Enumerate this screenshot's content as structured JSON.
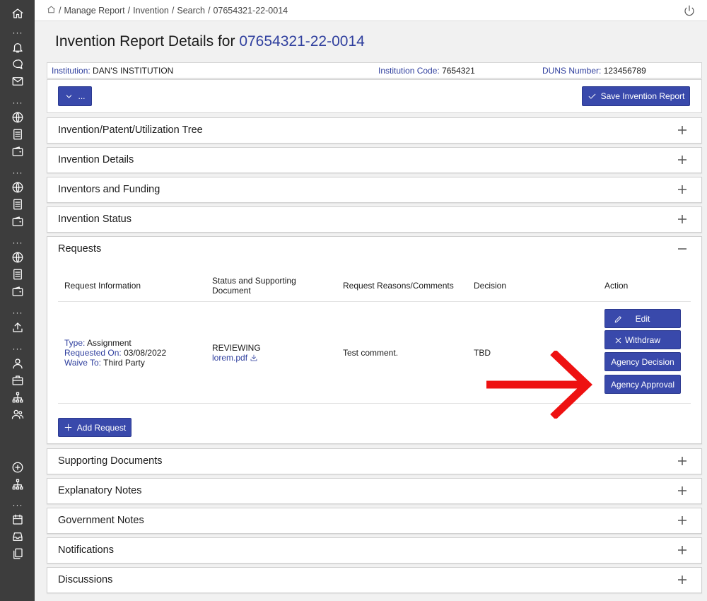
{
  "colors": {
    "accent": "#3949ab",
    "link": "#2f3f9e",
    "sidebar": "#3d3d3d",
    "annotation_arrow": "#ee1111"
  },
  "breadcrumb": {
    "items": [
      "Manage Report",
      "Invention",
      "Search",
      "07654321-22-0014"
    ],
    "separator": "/"
  },
  "page": {
    "title_prefix": "Invention Report Details for",
    "report_id": "07654321-22-0014"
  },
  "info": {
    "institution_label": "Institution:",
    "institution_value": "DAN'S INSTITUTION",
    "code_label": "Institution Code:",
    "code_value": "7654321",
    "duns_label": "DUNS Number:",
    "duns_value": "123456789"
  },
  "toolbar": {
    "more_label": "...",
    "save_label": "Save Invention Report"
  },
  "panels": {
    "tree": "Invention/Patent/Utilization Tree",
    "details": "Invention Details",
    "inventors": "Inventors and Funding",
    "status": "Invention Status",
    "requests": "Requests",
    "supporting": "Supporting Documents",
    "explanatory": "Explanatory Notes",
    "government": "Government Notes",
    "notifications": "Notifications",
    "discussions": "Discussions"
  },
  "requests": {
    "headers": {
      "info": "Request Information",
      "status_line1": "Status and Supporting",
      "status_line2": "Document",
      "reasons": "Request Reasons/Comments",
      "decision": "Decision",
      "action": "Action"
    },
    "row": {
      "type_label": "Type:",
      "type_value": "Assignment",
      "requested_label": "Requested On:",
      "requested_value": "03/08/2022",
      "waive_label": "Waive To:",
      "waive_value": "Third Party",
      "status": "REVIEWING",
      "document": "lorem.pdf",
      "comment": "Test comment.",
      "decision": "TBD"
    },
    "actions": {
      "edit": "Edit",
      "withdraw": "Withdraw",
      "agency_decision": "Agency Decision",
      "agency_approval": "Agency Approval"
    },
    "add_label": "Add Request"
  },
  "icons": {
    "sidebar": [
      "home-icon",
      "bell-icon",
      "chat-icon",
      "mail-icon",
      "globe-icon",
      "document-icon",
      "wallet-icon",
      "upload-icon",
      "user-icon",
      "briefcase-icon",
      "org-chart-icon",
      "users-icon",
      "add-circle-icon",
      "calendar-icon",
      "inbox-icon",
      "files-icon"
    ]
  }
}
